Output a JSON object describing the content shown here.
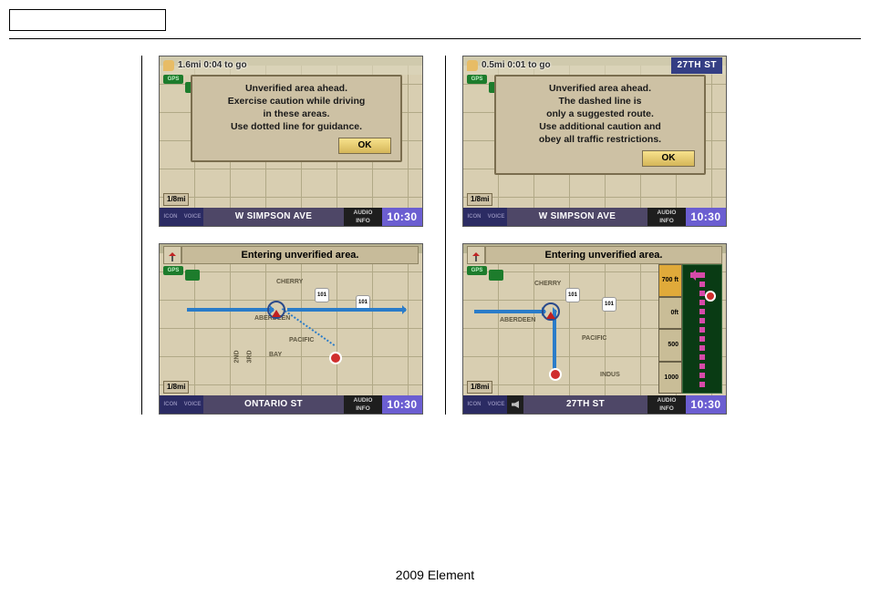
{
  "footer": "2009  Element",
  "panel_tl": {
    "distance": "1.6mi 0:04 to go",
    "dialog": {
      "l1": "Unverified area ahead.",
      "l2": "Exercise caution while driving",
      "l3": "in these areas.",
      "l4": "Use dotted line for guidance.",
      "ok": "OK"
    },
    "gps": "GPS",
    "scale": "1/8mi",
    "street": "W SIMPSON AVE",
    "audio_l1": "AUDIO",
    "audio_l2": "INFO",
    "clock": "10:30",
    "bot_icon": "ICON",
    "bot_voice": "VOICE"
  },
  "panel_tr": {
    "distance": "0.5mi 0:01 to go",
    "street_sign": "27TH ST",
    "dialog": {
      "l1": "Unverified area ahead.",
      "l2": "The dashed line is",
      "l3": "only a suggested route.",
      "l4": "Use additional caution and",
      "l5": "obey all traffic restrictions.",
      "ok": "OK"
    },
    "gps": "GPS",
    "scale": "1/8mi",
    "street": "W SIMPSON AVE",
    "audio_l1": "AUDIO",
    "audio_l2": "INFO",
    "clock": "10:30",
    "bot_icon": "ICON",
    "bot_voice": "VOICE"
  },
  "panel_bl": {
    "banner": "Entering unverified area.",
    "gps": "GPS",
    "scale": "1/8mi",
    "street": "ONTARIO ST",
    "audio_l1": "AUDIO",
    "audio_l2": "INFO",
    "clock": "10:30",
    "bot_icon": "ICON",
    "bot_voice": "VOICE",
    "labels": {
      "a": "CHERRY",
      "b": "ABERDEEN",
      "c": "PACIFIC",
      "d": "BAY",
      "e": "2ND",
      "f": "3RD"
    },
    "hwy": "101"
  },
  "panel_br": {
    "banner": "Entering unverified area.",
    "gps": "GPS",
    "scale": "1/8mi",
    "street": "27TH ST",
    "audio_l1": "AUDIO",
    "audio_l2": "INFO",
    "clock": "10:30",
    "bot_icon": "ICON",
    "bot_voice": "VOICE",
    "labels": {
      "a": "CHERRY",
      "b": "ABERDEEN",
      "c": "PACIFIC",
      "d": "INDUS"
    },
    "hwy": "101",
    "guide": {
      "d0": "700 ft",
      "d1": "0ft",
      "d2": "500",
      "d3": "1000"
    }
  }
}
